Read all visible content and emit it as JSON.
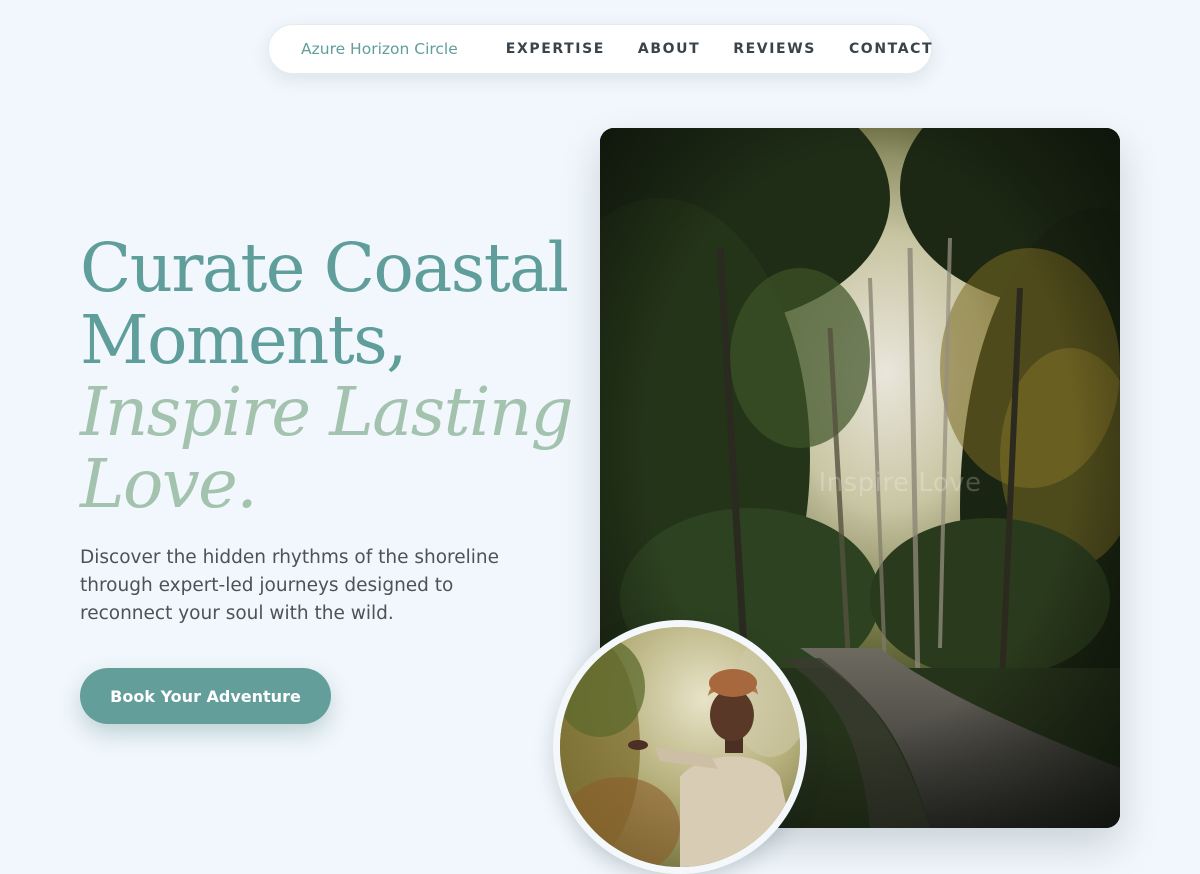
{
  "nav": {
    "brand": "Azure Horizon Circle",
    "links": [
      "EXPERTISE",
      "ABOUT",
      "REVIEWS",
      "CONTACT"
    ]
  },
  "hero": {
    "headline_line1": "Curate Coastal",
    "headline_line2": "Moments,",
    "headline_line3": "Inspire Lasting",
    "headline_line4": "Love.",
    "subtext": "Discover the hidden rhythms of the shoreline through expert-led journeys designed to reconnect your soul with the wild.",
    "cta_label": "Book Your Adventure",
    "photo_overlay_text": "Inspire Love"
  },
  "colors": {
    "background": "#f1f7fc",
    "brand_teal": "#5f9e9b",
    "accent_sage": "#a3c3ae",
    "body_text": "#4a525a",
    "nav_text": "#3a434a"
  }
}
